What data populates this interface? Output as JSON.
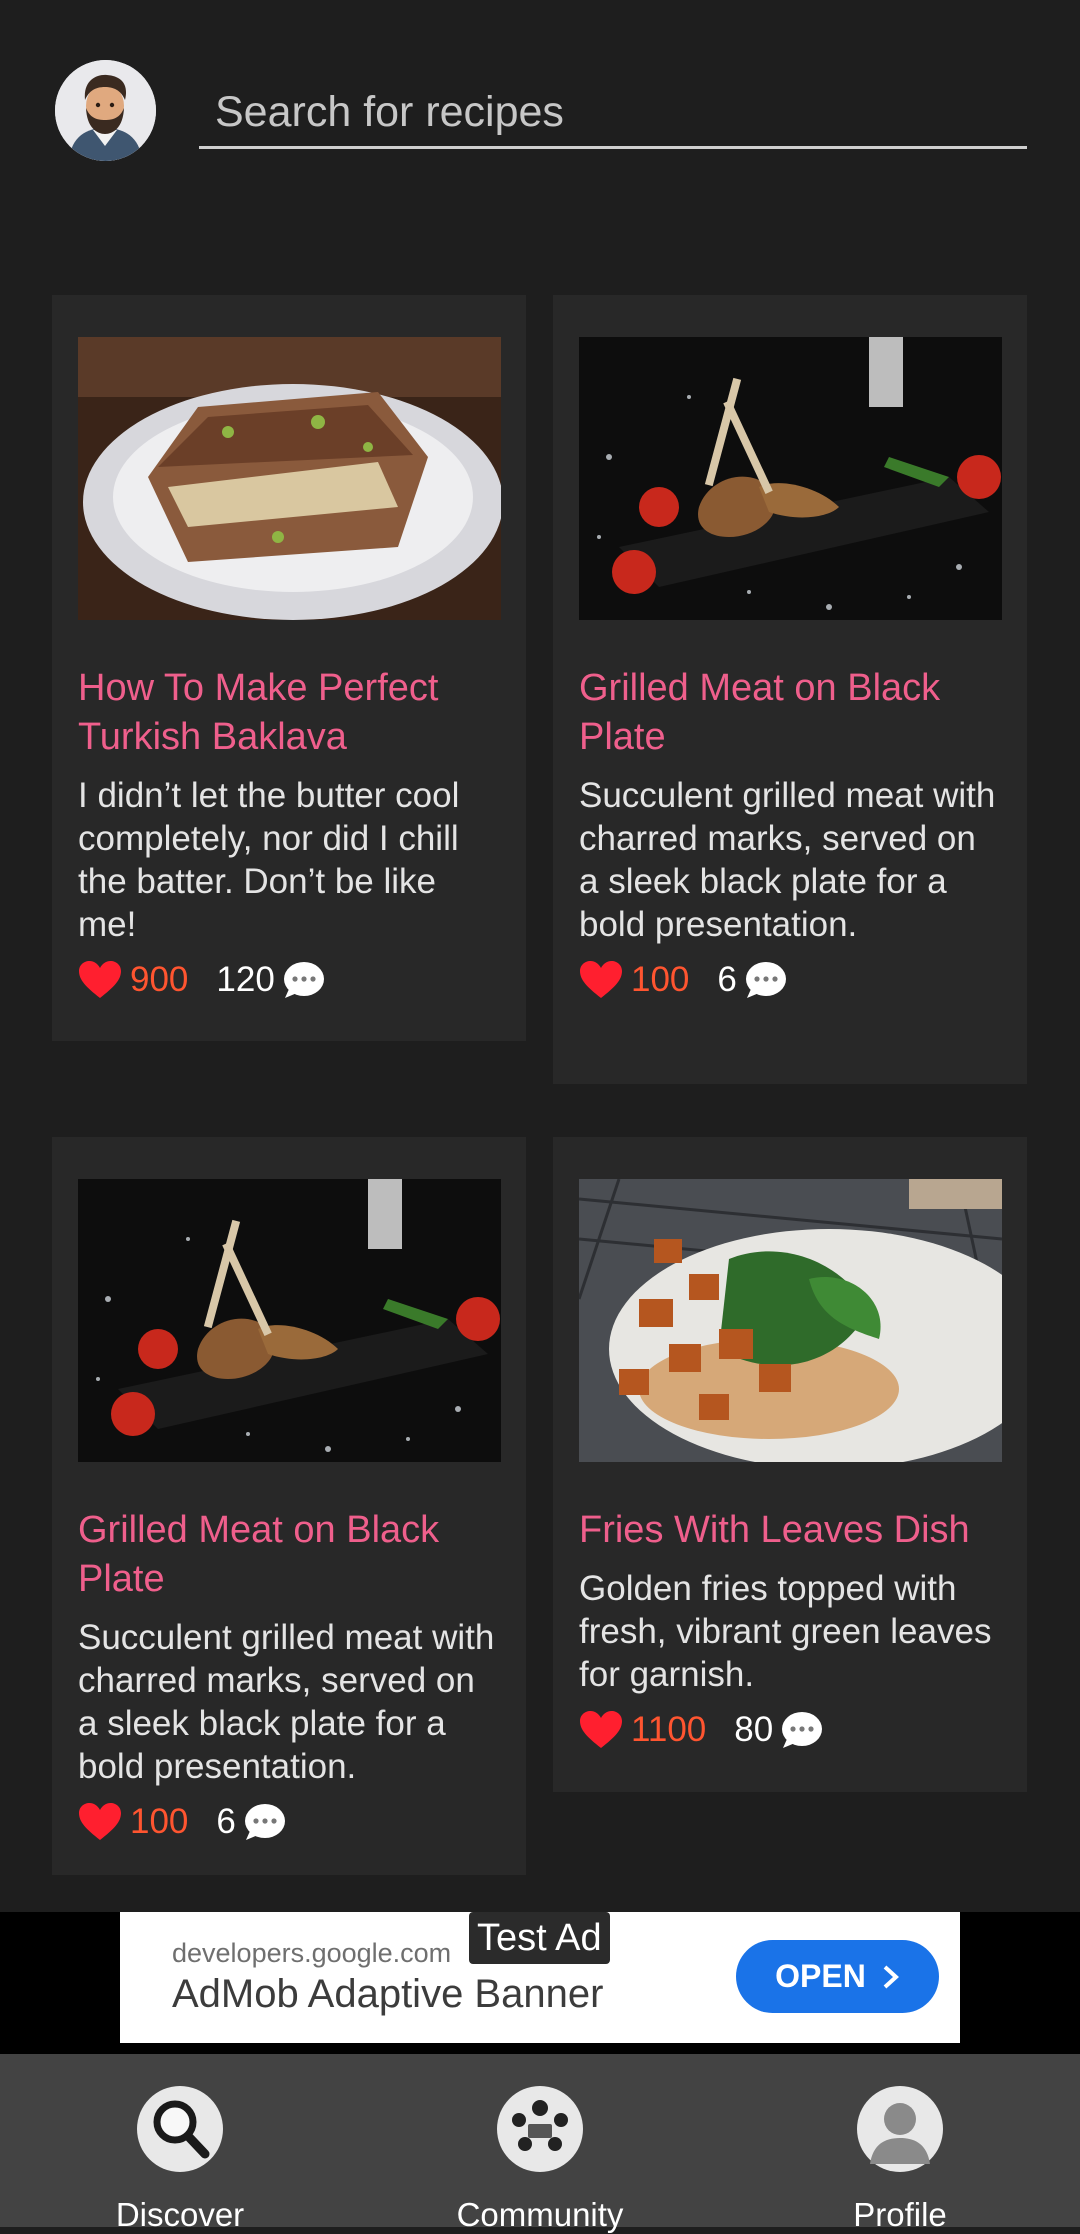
{
  "search": {
    "placeholder": "Search for recipes"
  },
  "cards": [
    {
      "title": "How To Make Perfect Turkish Baklava",
      "description": "I didn’t let the butter cool completely, nor did I chill the batter. Don’t be like me!",
      "likes": "900",
      "comments": "120"
    },
    {
      "title": "Grilled Meat on Black Plate",
      "description": "Succulent grilled meat with charred marks, served on a sleek black plate for a bold presentation.",
      "likes": "100",
      "comments": "6"
    },
    {
      "title": "Grilled Meat on Black Plate",
      "description": "Succulent grilled meat with charred marks, served on a sleek black plate for a bold presentation.",
      "likes": "100",
      "comments": "6"
    },
    {
      "title": "Fries With Leaves Dish",
      "description": "Golden fries topped with fresh, vibrant green leaves for garnish.",
      "likes": "1100",
      "comments": "80"
    }
  ],
  "ad": {
    "tag": "Test Ad",
    "url": "developers.google.com",
    "title": "AdMob Adaptive Banner",
    "button": "OPEN"
  },
  "nav": {
    "discover": "Discover",
    "community": "Community",
    "profile": "Profile"
  },
  "colors": {
    "title_pink": "#ef5f8c",
    "likes_orange": "#ff5530",
    "card_bg": "#282828",
    "open_blue": "#1a73e8"
  }
}
